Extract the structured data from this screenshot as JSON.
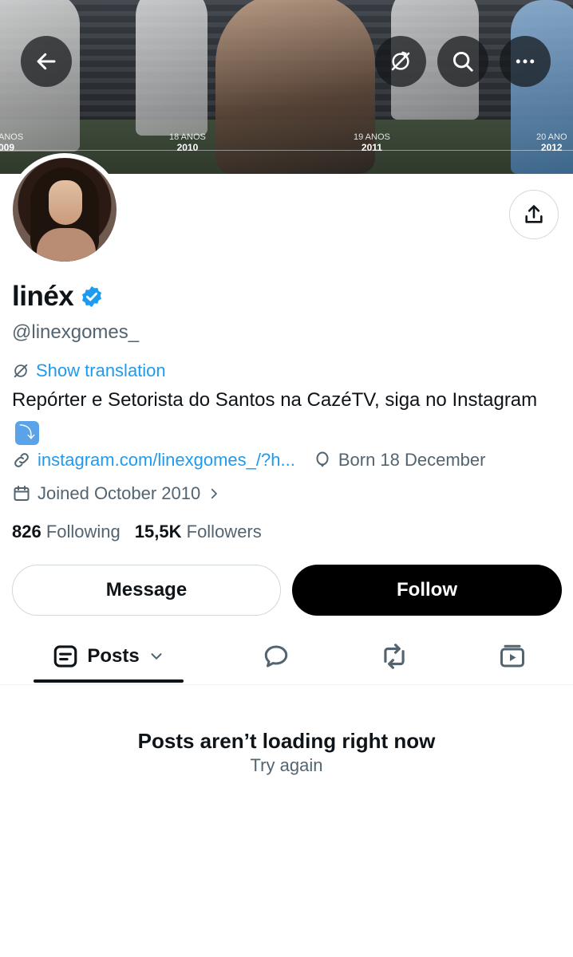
{
  "banner": {
    "timeline": [
      {
        "age": "ANOS",
        "year": "009"
      },
      {
        "age": "18 ANOS",
        "year": "2010"
      },
      {
        "age": "19 ANOS",
        "year": "2011"
      },
      {
        "age": "20 ANO",
        "year": "2012"
      }
    ],
    "icons": {
      "back": "arrow-left-icon",
      "translate": "translate-icon",
      "search": "search-icon",
      "more": "more-icon"
    }
  },
  "profile": {
    "display_name": "linéx",
    "verified": true,
    "verified_color": "#1d9bf0",
    "handle": "@linexgomes_",
    "show_translation": "Show translation",
    "bio_text": "Repórter e Setorista do Santos na CazéTV, siga no Instagram",
    "bio_emoji": "⤵",
    "link": "instagram.com/linexgomes_/?h...",
    "born": "Born 18 December",
    "joined": "Joined October 2010",
    "following_count": "826",
    "following_label": "Following",
    "followers_count": "15,5K",
    "followers_label": "Followers"
  },
  "actions": {
    "message": "Message",
    "follow": "Follow"
  },
  "tabs": {
    "posts": "Posts",
    "icons": [
      "posts-icon",
      "replies-icon",
      "reposts-icon",
      "media-icon"
    ]
  },
  "feed": {
    "error_title": "Posts aren’t loading right now",
    "retry": "Try again"
  },
  "colors": {
    "accent": "#1d9bf0",
    "text": "#0f1419",
    "secondary": "#536471",
    "follow_bg": "#000000"
  }
}
